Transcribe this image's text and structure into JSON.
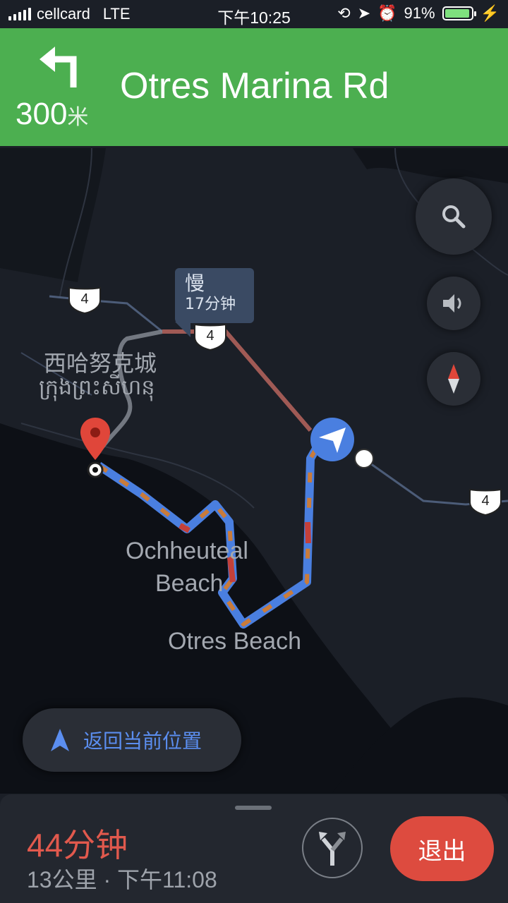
{
  "status_bar": {
    "carrier": "cellcard",
    "network": "LTE",
    "time": "下午10:25",
    "battery": "91%"
  },
  "navigation": {
    "distance_value": "300",
    "distance_unit": "米",
    "street": "Otres Marina Rd",
    "turn_icon": "turn-left-icon"
  },
  "map": {
    "route_label_status": "慢",
    "route_label_time": "17分钟",
    "city_name_cn": "西哈努克城",
    "city_name_km": "ក្រុងព្រះសីហនុ",
    "place_1_line1": "Ochheuteal",
    "place_1_line2": "Beach",
    "place_2": "Otres Beach",
    "road_shields": [
      "4",
      "4",
      "4"
    ]
  },
  "controls": {
    "search_icon": "search-icon",
    "sound_icon": "volume-icon",
    "compass_icon": "compass-icon",
    "recenter_label": "返回当前位置"
  },
  "trip": {
    "eta": "44分钟",
    "summary": "13公里 · 下午11:08",
    "exit_label": "退出"
  },
  "colors": {
    "nav_green": "#4caf50",
    "route_blue": "#4a7fe0",
    "exit_red": "#dd4b3f"
  }
}
